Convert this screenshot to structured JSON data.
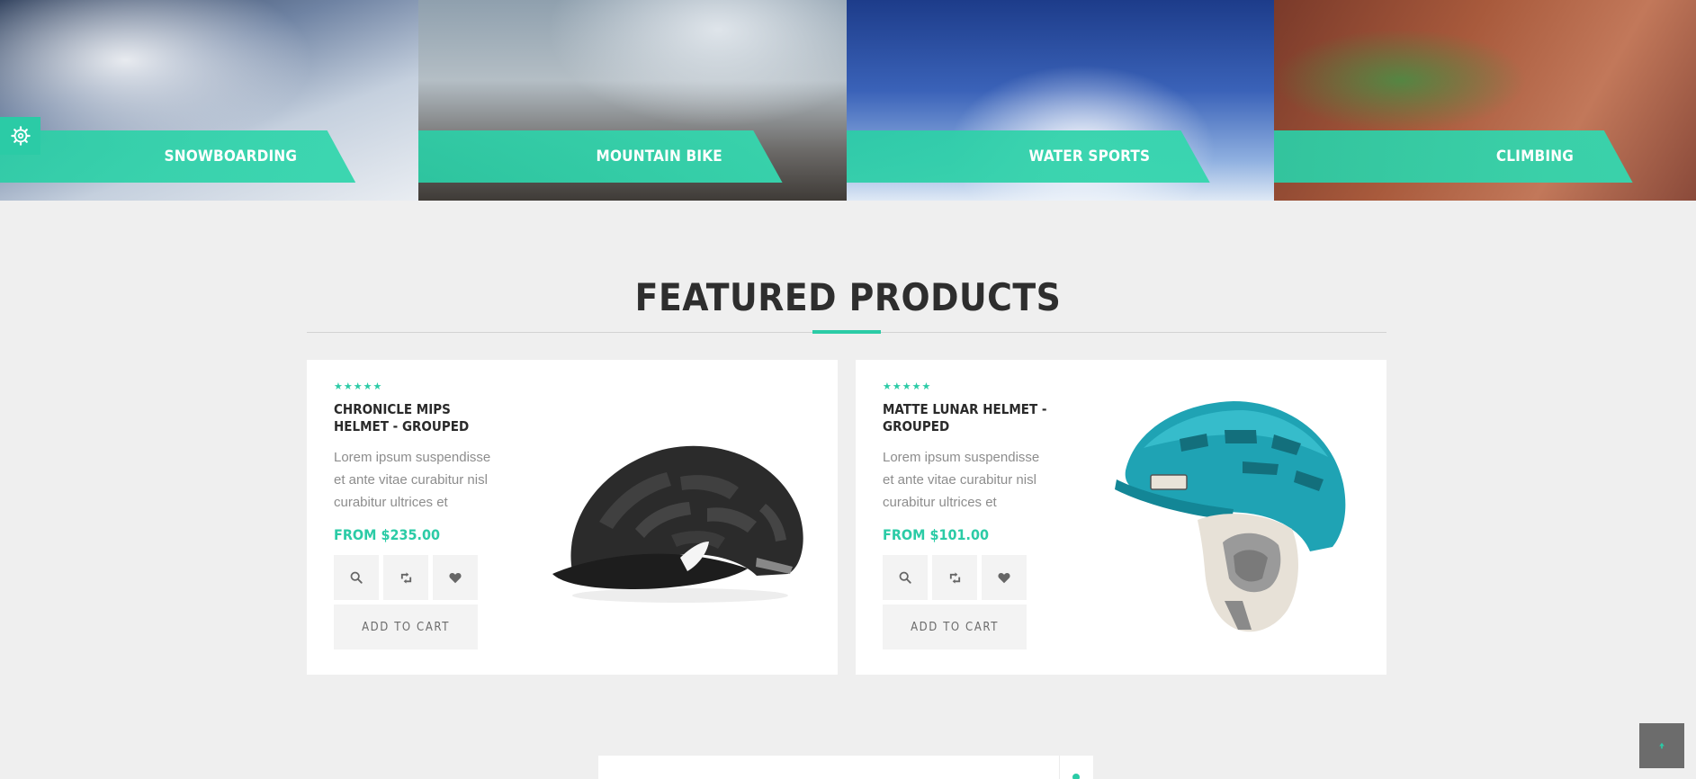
{
  "categories": [
    {
      "label": "SNOWBOARDING"
    },
    {
      "label": "MOUNTAIN BIKE"
    },
    {
      "label": "WATER SPORTS"
    },
    {
      "label": "CLIMBING"
    }
  ],
  "settings_icon": "gear-icon",
  "section": {
    "title": "FEATURED PRODUCTS"
  },
  "products": [
    {
      "rating": 5,
      "name": "CHRONICLE MIPS HELMET - GROUPED",
      "description": "Lorem ipsum suspendisse et ante vitae curabitur nisl curabitur ultrices et",
      "price": "FROM $235.00",
      "add_to_cart": "ADD TO CART",
      "image": "black-bike-helmet"
    },
    {
      "rating": 5,
      "name": "MATTE LUNAR HELMET - GROUPED",
      "description": "Lorem ipsum suspendisse et ante vitae curabitur nisl curabitur ultrices et",
      "price": "FROM $101.00",
      "add_to_cart": "ADD TO CART",
      "image": "teal-ski-helmet"
    }
  ],
  "action_icons": [
    "search-icon",
    "compare-icon",
    "heart-icon"
  ],
  "scroll_top_icon": "arrow-up-icon",
  "colors": {
    "accent": "#2bcba6",
    "heading": "#2e2e2e",
    "background": "#efefef"
  }
}
